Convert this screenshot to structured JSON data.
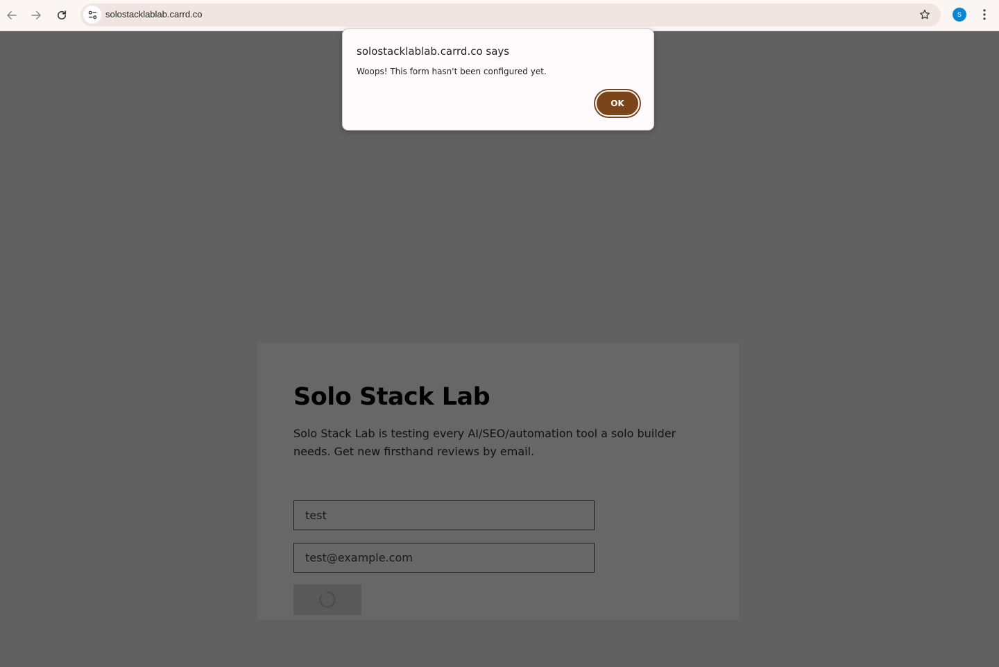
{
  "browser": {
    "url": "solostacklablab.carrd.co",
    "profile_initial": "S"
  },
  "dialog": {
    "title": "solostacklablab.carrd.co says",
    "message": "Woops! This form hasn't been configured yet.",
    "ok_label": "OK"
  },
  "page": {
    "title": "Solo Stack Lab",
    "description": "Solo Stack Lab is testing every AI/SEO/automation tool a solo builder needs. Get new firsthand reviews by email.",
    "form": {
      "name_value": "test",
      "email_value": "test@example.com",
      "submit_state": "loading"
    }
  },
  "colors": {
    "dialog_button": "#7b4419",
    "overlay": "#616161",
    "card": "#676767",
    "avatar": "#0b85d4"
  },
  "icons": {
    "back": "arrow-left-icon",
    "forward": "arrow-right-icon",
    "reload": "reload-icon",
    "site_info": "tune-icon",
    "bookmark": "star-outline-icon",
    "menu": "kebab-menu-icon",
    "loading": "spinner-icon"
  }
}
